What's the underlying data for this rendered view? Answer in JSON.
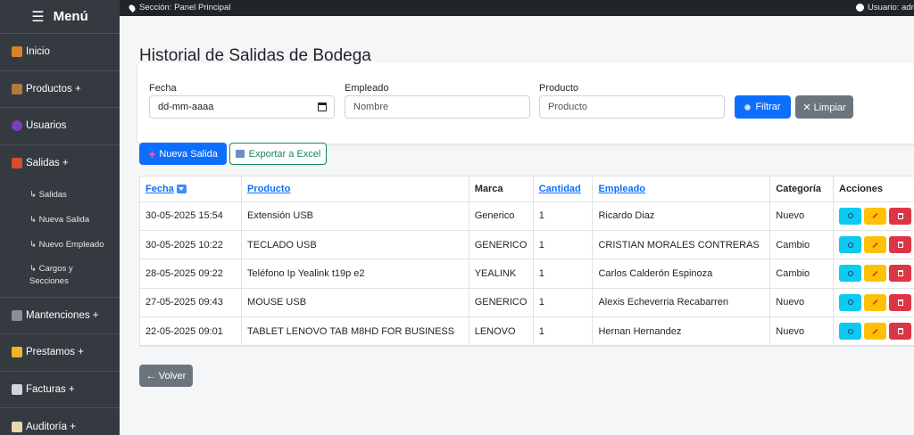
{
  "sidebar": {
    "title": "Menú",
    "items": [
      {
        "label": "Inicio",
        "icon": "house-icon"
      },
      {
        "label": "Productos +",
        "icon": "box-icon"
      },
      {
        "label": "Usuarios",
        "icon": "user-icon"
      },
      {
        "label": "Salidas +",
        "icon": "truck-icon"
      }
    ],
    "subitems": [
      "↳ Salidas",
      "↳ Nueva Salida",
      "↳ Nuevo Empleado",
      "↳ Cargos y Secciones"
    ],
    "items2": [
      {
        "label": "Mantenciones +",
        "icon": "wrench-icon"
      },
      {
        "label": "Prestamos +",
        "icon": "handshake-icon"
      },
      {
        "label": "Facturas +",
        "icon": "invoice-icon"
      },
      {
        "label": "Auditoría +",
        "icon": "clipboard-icon"
      }
    ]
  },
  "topbar": {
    "section": "Sección: Panel Principal",
    "user": "Usuario: adm"
  },
  "main": {
    "title": "Historial de Salidas de Bodega",
    "filters": {
      "fecha_label": "Fecha",
      "fecha_value": "dd-mm-aaaa",
      "empleado_label": "Empleado",
      "empleado_placeholder": "Nombre",
      "producto_label": "Producto",
      "producto_placeholder": "Producto",
      "filtrar": "Filtrar",
      "limpiar": "✕ Limpiar"
    },
    "nueva_salida": "Nueva Salida",
    "exportar": "Exportar a Excel",
    "volver": "← Volver"
  },
  "table": {
    "headers": [
      "Fecha",
      "Producto",
      "Marca",
      "Cantidad",
      "Empleado",
      "Categoría",
      "Acciones"
    ],
    "rows": [
      [
        "30-05-2025 15:54",
        "Extensión USB",
        "Generico",
        "1",
        "Ricardo Diaz",
        "Nuevo"
      ],
      [
        "30-05-2025 10:22",
        "TECLADO USB",
        "GENERICO",
        "1",
        "CRISTIAN MORALES CONTRERAS",
        "Cambio"
      ],
      [
        "28-05-2025 09:22",
        "Teléfono Ip Yealink t19p e2",
        "YEALINK",
        "1",
        "Carlos Calderón Espinoza",
        "Cambio"
      ],
      [
        "27-05-2025 09:43",
        "MOUSE USB",
        "GENERICO",
        "1",
        "Alexis Echeverria Recabarren",
        "Nuevo"
      ],
      [
        "22-05-2025 09:01",
        "TABLET LENOVO TAB M8HD FOR BUSINESS",
        "LENOVO",
        "1",
        "Hernan Hernandez",
        "Nuevo"
      ]
    ]
  },
  "colors": {
    "sidebar": "#343a40",
    "topbar": "#212529",
    "primary": "#0d6efd",
    "secondary": "#6c757d",
    "info": "#0dcaf0",
    "warning": "#ffc107",
    "danger": "#dc3545",
    "success": "#198754"
  }
}
